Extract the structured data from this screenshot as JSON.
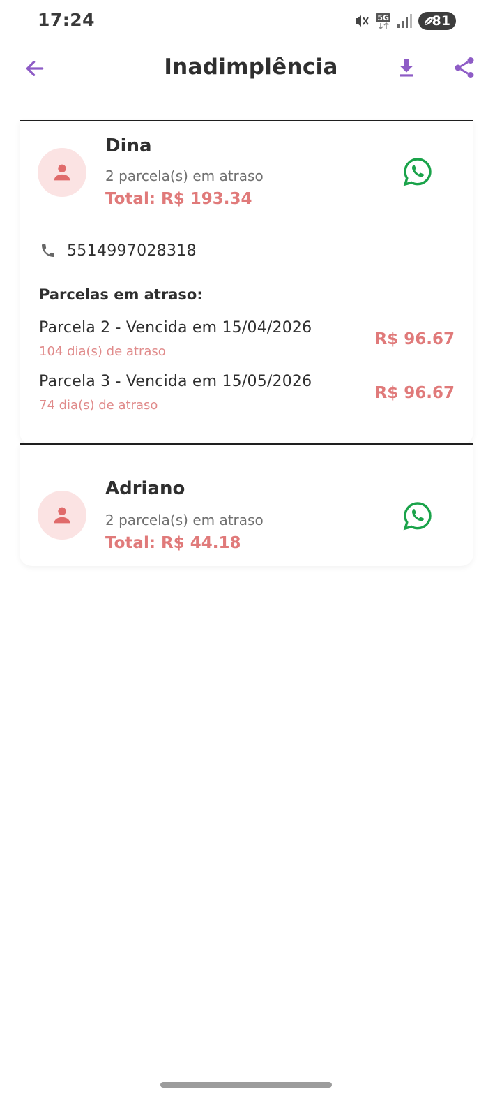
{
  "status_bar": {
    "time": "17:24",
    "network": "5G",
    "battery": "81",
    "icons": [
      "vibrate-mute-icon",
      "5g-icon",
      "signal-icon",
      "battery-saver-icon"
    ]
  },
  "app_bar": {
    "title": "Inadimplência",
    "icons": [
      "arrow-left-icon",
      "download-icon",
      "share-icon"
    ]
  },
  "colors": {
    "accent": "#8e5cc6",
    "overdue": "#e07a7a",
    "avatar_bg": "#fbe3e3",
    "whatsapp": "#1aa34a"
  },
  "debtors": [
    {
      "name": "Dina",
      "installments_text": "2 parcela(s) em atraso",
      "total": "Total: R$ 193.34",
      "phone": "5514997028318",
      "section_title": "Parcelas em atraso:",
      "installments": [
        {
          "label": "Parcela 2 - Vencida em 15/04/2026",
          "days": "104 dia(s) de atraso",
          "value": "R$ 96.67"
        },
        {
          "label": "Parcela 3 - Vencida em 15/05/2026",
          "days": "74 dia(s) de atraso",
          "value": "R$ 96.67"
        }
      ]
    },
    {
      "name": "Adriano",
      "installments_text": "2 parcela(s) em atraso",
      "total": "Total: R$ 44.18"
    }
  ]
}
